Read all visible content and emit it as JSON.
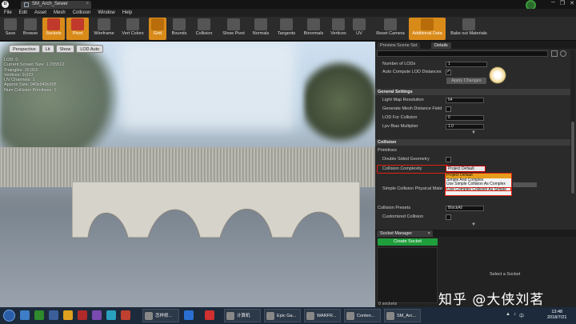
{
  "window": {
    "tab_title": "SM_Arch_Sewer",
    "close_glyph": "×",
    "controls": [
      "─",
      "❐",
      "✕"
    ]
  },
  "menu": [
    "File",
    "Edit",
    "Asset",
    "Mesh",
    "Collision",
    "Window",
    "Help"
  ],
  "toolbar": {
    "items": [
      {
        "label": "Save",
        "icon": "save-icon"
      },
      {
        "label": "Browse",
        "icon": "browse-icon"
      },
      {
        "label": "Sockets",
        "icon": "sockets-icon"
      },
      {
        "label": "Pivot",
        "icon": "pivot-icon"
      },
      {
        "label": "Wireframe",
        "icon": "wireframe-icon"
      },
      {
        "label": "Vert Colors",
        "icon": "vert-colors-icon"
      },
      {
        "label": "Grid",
        "icon": "grid-icon"
      },
      {
        "label": "Bounds",
        "icon": "bounds-icon"
      },
      {
        "label": "Collision",
        "icon": "collision-icon"
      },
      {
        "label": "Show Pivot",
        "icon": "show-pivot-icon"
      },
      {
        "label": "Normals",
        "icon": "normals-icon"
      },
      {
        "label": "Tangents",
        "icon": "tangents-icon"
      },
      {
        "label": "Binormals",
        "icon": "binormals-icon"
      },
      {
        "label": "Vertices",
        "icon": "vertices-icon"
      },
      {
        "label": "UV",
        "icon": "uv-icon"
      },
      {
        "label": "Reset Camera",
        "icon": "reset-camera-icon"
      },
      {
        "label": "Additional Data",
        "icon": "additional-data-icon"
      },
      {
        "label": "Bake out Materials",
        "icon": "bake-materials-icon"
      }
    ]
  },
  "viewport": {
    "buttons": [
      "Perspective",
      "Lit",
      "Show",
      "LOD Auto"
    ],
    "stats": [
      "LOD: 0",
      "Current Screen Size: 1.765512",
      "Triangles: 10,916",
      "Vertices: 9,033",
      "UV Channels: 1",
      "Approx Size: 949x949x305",
      "Num Collision Primitives: 1"
    ]
  },
  "details": {
    "tabs": [
      "Preview Scene Set",
      "Details"
    ],
    "lod": {
      "number_of_lods_label": "Number of LODs",
      "number_of_lods_value": "1",
      "auto_compute_label": "Auto Compute LOD Distances",
      "apply_changes": "Apply Changes"
    },
    "general_settings": {
      "header": "General Settings",
      "light_map_res_label": "Light Map Resolution",
      "light_map_res_value": "64",
      "gen_mesh_dist_label": "Generate Mesh Distance Field",
      "lod_for_collision_label": "LOD For Collision",
      "lod_for_collision_value": "0",
      "lpv_bias_label": "Lpv Bias Multiplier",
      "lpv_bias_value": "1.0"
    },
    "collision": {
      "header": "Collision",
      "primitives_label": "Primitives",
      "double_sided_label": "Double Sided Geometry",
      "complexity_label": "Collision Complexity",
      "complexity_value": "Project Default",
      "complexity_options": [
        "Project Default",
        "Simple And Complex",
        "Use Simple Collision As Complex",
        "Use Complex Collision As Simple"
      ],
      "simple_physical_label": "Simple Collision Physical Mate",
      "presets_label": "Collision Presets",
      "presets_value": "BlockAll",
      "customized_label": "Customized Collision"
    }
  },
  "socket_manager": {
    "title": "Socket Manager",
    "close_glyph": "×",
    "create_button": "Create Socket",
    "count": "0 sockets",
    "empty_hint": "Select a Socket"
  },
  "watermark": "知乎 @大侠刘茗",
  "taskbar": {
    "items": [
      "怎样修...",
      "计算机",
      "Epic Ga...",
      "WARFR...",
      "Conten...",
      "SM_Arc..."
    ],
    "time": "13:48",
    "date": "2018/7/21",
    "tray_glyphs": [
      "▲",
      "♪",
      "中"
    ]
  }
}
